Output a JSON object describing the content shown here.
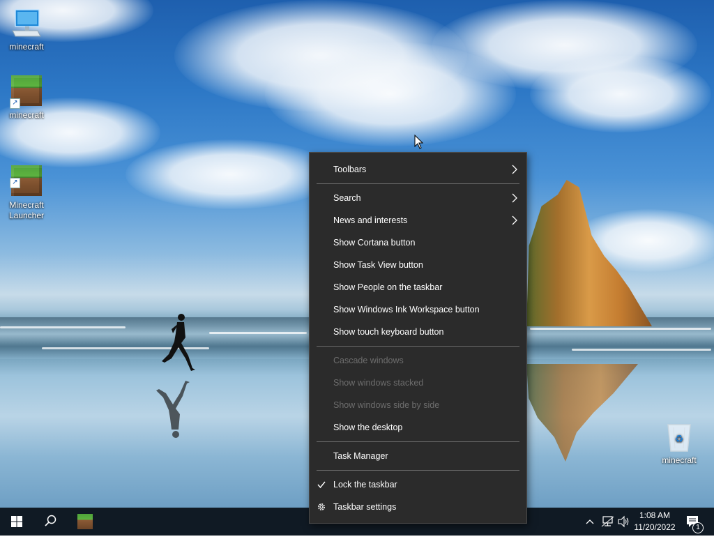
{
  "desktop": {
    "icons": [
      {
        "label": "minecraft",
        "icon": "computer-icon"
      },
      {
        "label": "minecraft",
        "icon": "grass-block-icon",
        "shortcut": true
      },
      {
        "label": "Minecraft\nLauncher",
        "icon": "grass-block-icon",
        "shortcut": true
      },
      {
        "label": "minecraft",
        "icon": "recycle-bin-icon"
      }
    ]
  },
  "context_menu": {
    "items": [
      {
        "label": "Toolbars",
        "submenu": true,
        "enabled": true
      },
      {
        "label": "Search",
        "submenu": true,
        "enabled": true
      },
      {
        "label": "News and interests",
        "submenu": true,
        "enabled": true
      },
      {
        "label": "Show Cortana button",
        "enabled": true
      },
      {
        "label": "Show Task View button",
        "enabled": true
      },
      {
        "label": "Show People on the taskbar",
        "enabled": true
      },
      {
        "label": "Show Windows Ink Workspace button",
        "enabled": true
      },
      {
        "label": "Show touch keyboard button",
        "enabled": true
      },
      {
        "label": "Cascade windows",
        "enabled": false
      },
      {
        "label": "Show windows stacked",
        "enabled": false
      },
      {
        "label": "Show windows side by side",
        "enabled": false
      },
      {
        "label": "Show the desktop",
        "enabled": true
      },
      {
        "label": "Task Manager",
        "enabled": true
      },
      {
        "label": "Lock the taskbar",
        "enabled": true,
        "checked": true
      },
      {
        "label": "Taskbar settings",
        "enabled": true,
        "icon": "gear-icon"
      }
    ]
  },
  "taskbar": {
    "buttons": [
      "windows-start-icon",
      "search-icon",
      "minecraft-taskbar-icon"
    ],
    "tray_icons": [
      "chevron-up-icon",
      "network-icon",
      "volume-icon"
    ],
    "time": "1:08 AM",
    "date": "11/20/2022",
    "notification_count": "1"
  },
  "colors": {
    "menu_bg": "#2b2b2b",
    "menu_disabled": "#6d6d6d",
    "taskbar_bg": "#101a24"
  }
}
